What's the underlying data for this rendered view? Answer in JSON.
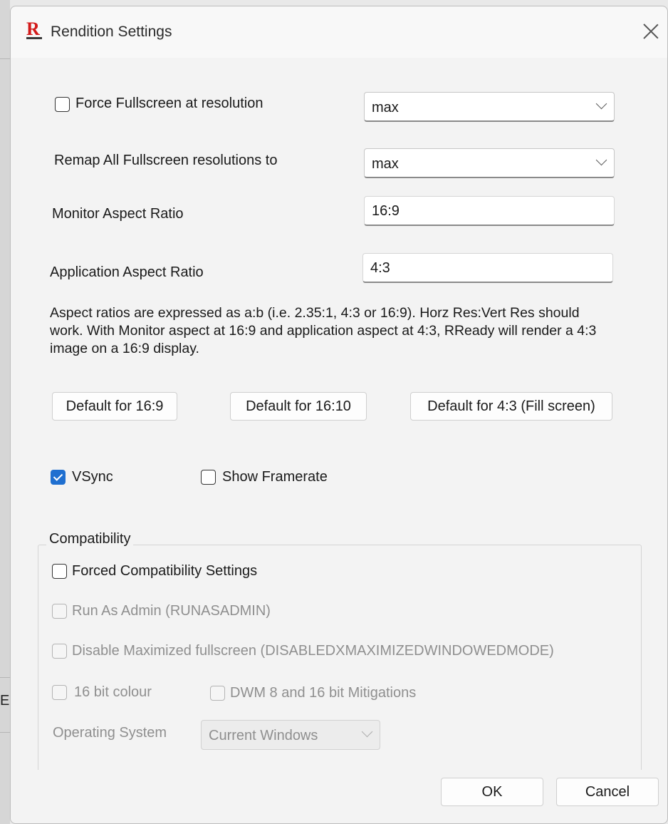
{
  "background": {
    "partial_text": "E"
  },
  "window": {
    "title": "Rendition Settings",
    "icon": "app-r-icon",
    "accent": "#d31a1a"
  },
  "force_fullscreen": {
    "label": "Force Fullscreen at resolution",
    "checked": false,
    "value": "max"
  },
  "remap": {
    "label": "Remap All Fullscreen resolutions to",
    "value": "max"
  },
  "monitor_aspect": {
    "label": "Monitor Aspect Ratio",
    "value": "16:9"
  },
  "app_aspect": {
    "label": "Application Aspect Ratio",
    "value": "4:3"
  },
  "description": "Aspect ratios are expressed as a:b (i.e. 2.35:1, 4:3 or 16:9). Horz Res:Vert Res should work. With Monitor aspect at 16:9 and application aspect at 4:3, RReady will render a 4:3 image on a 16:9 display.",
  "presets": {
    "btn_16_9": "Default for 16:9",
    "btn_16_10": "Default for 16:10",
    "btn_4_3": "Default for 4:3 (Fill screen)"
  },
  "vsync": {
    "label": "VSync",
    "checked": true,
    "color": "#1f6fd0"
  },
  "show_framerate": {
    "label": "Show Framerate",
    "checked": false
  },
  "compatibility": {
    "title": "Compatibility",
    "forced": {
      "label": "Forced Compatibility Settings",
      "checked": false
    },
    "run_as_admin": {
      "label": "Run As Admin  (RUNASADMIN)",
      "enabled": false
    },
    "disable_max": {
      "label": "Disable Maximized fullscreen (DISABLEDXMAXIMIZEDWINDOWEDMODE)",
      "enabled": false
    },
    "bit16": {
      "label": "16 bit colour",
      "enabled": false
    },
    "dwm": {
      "label": "DWM 8 and 16 bit Mitigations",
      "enabled": false
    },
    "os_label": "Operating System",
    "os_value": "Current Windows"
  },
  "footer": {
    "ok": "OK",
    "cancel": "Cancel"
  }
}
